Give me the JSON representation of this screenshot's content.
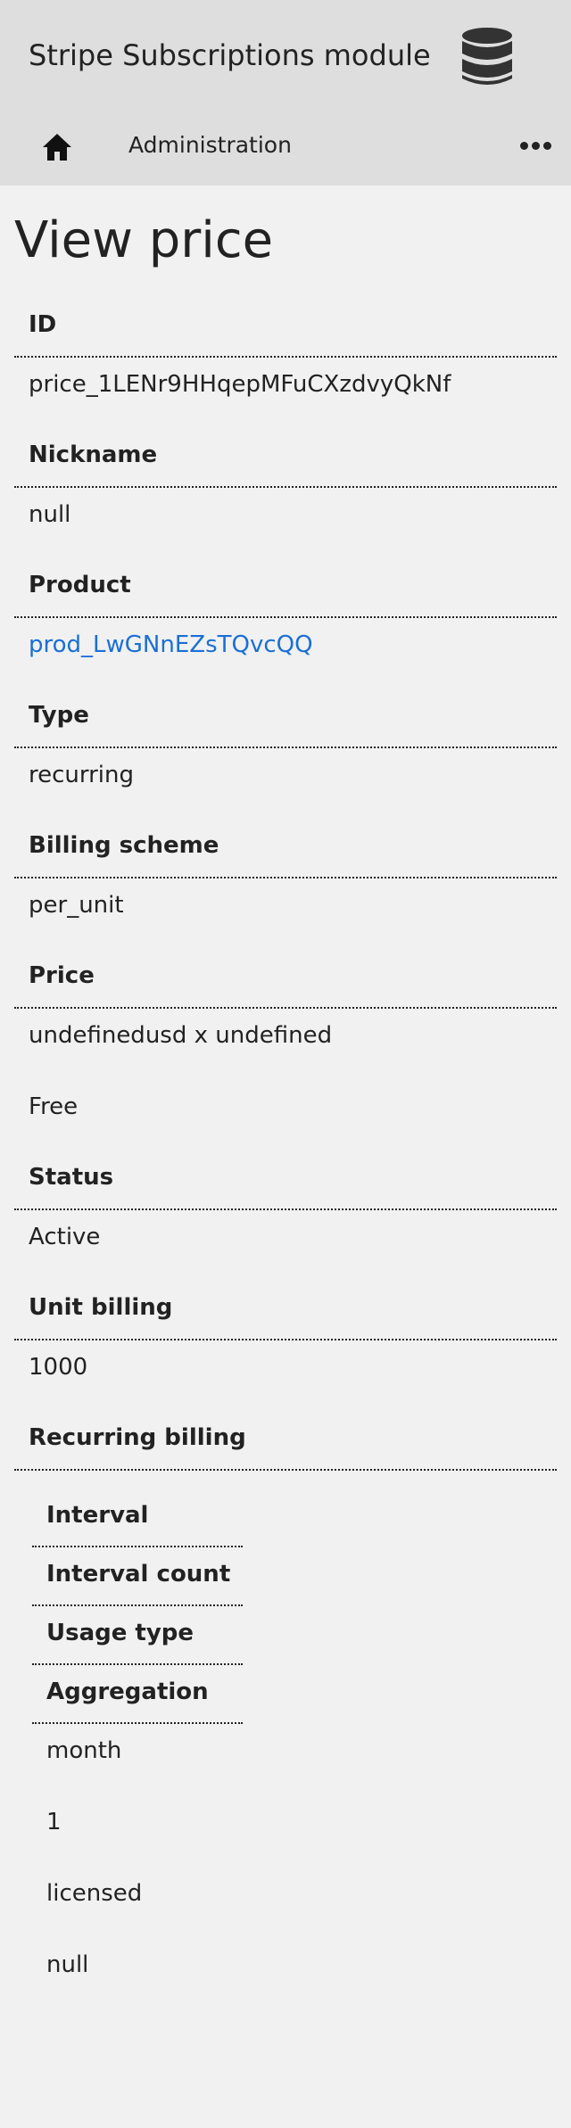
{
  "app": {
    "title": "Stripe Subscriptions module",
    "icon": "database-icon"
  },
  "nav": {
    "home_icon": "home-icon",
    "administration_label": "Administration",
    "more_icon": "more-options-icon"
  },
  "page": {
    "title": "View price"
  },
  "fields": {
    "id": {
      "label": "ID",
      "value": "price_1LENr9HHqepMFuCXzdvyQkNf"
    },
    "nickname": {
      "label": "Nickname",
      "value": "null"
    },
    "product": {
      "label": "Product",
      "value": "prod_LwGNnEZsTQvcQQ"
    },
    "type": {
      "label": "Type",
      "value": "recurring"
    },
    "billing_scheme": {
      "label": "Billing scheme",
      "value": "per_unit"
    },
    "price": {
      "label": "Price",
      "value": "undefinedusd x undefined",
      "note": "Free"
    },
    "status": {
      "label": "Status",
      "value": "Active"
    },
    "unit_billing": {
      "label": "Unit billing",
      "value": "1000"
    },
    "recurring_billing": {
      "label": "Recurring billing"
    }
  },
  "recurring": {
    "headers": [
      "Interval",
      "Interval count",
      "Usage type",
      "Aggregation"
    ],
    "values": [
      "month",
      "1",
      "licensed",
      "null"
    ]
  },
  "colors": {
    "topbar_bg": "#dedede",
    "page_bg": "#f1f1f1",
    "text": "#222222",
    "link": "#1a6fd8"
  }
}
